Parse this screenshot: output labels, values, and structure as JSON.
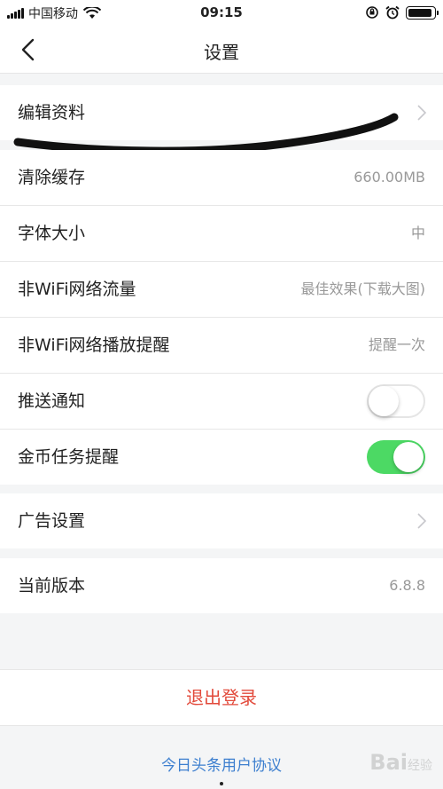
{
  "status_bar": {
    "carrier": "中国移动",
    "time": "09:15"
  },
  "nav": {
    "title": "设置"
  },
  "sections": {
    "profile": {
      "label": "编辑资料"
    },
    "cache": {
      "label": "清除缓存",
      "value": "660.00MB"
    },
    "font_size": {
      "label": "字体大小",
      "value": "中"
    },
    "non_wifi_traffic": {
      "label": "非WiFi网络流量",
      "value": "最佳效果(下载大图)"
    },
    "non_wifi_play": {
      "label": "非WiFi网络播放提醒",
      "value": "提醒一次"
    },
    "push": {
      "label": "推送通知",
      "enabled": false
    },
    "coin_task": {
      "label": "金币任务提醒",
      "enabled": true
    },
    "ads": {
      "label": "广告设置"
    },
    "version": {
      "label": "当前版本",
      "value": "6.8.8"
    }
  },
  "logout": {
    "label": "退出登录"
  },
  "agreement": {
    "label": "今日头条用户协议"
  },
  "watermark": {
    "text": "Bai",
    "suffix": "经验"
  },
  "colors": {
    "toggle_on": "#4cd964",
    "logout_red": "#e24a3b",
    "link_blue": "#3d7fcf"
  }
}
